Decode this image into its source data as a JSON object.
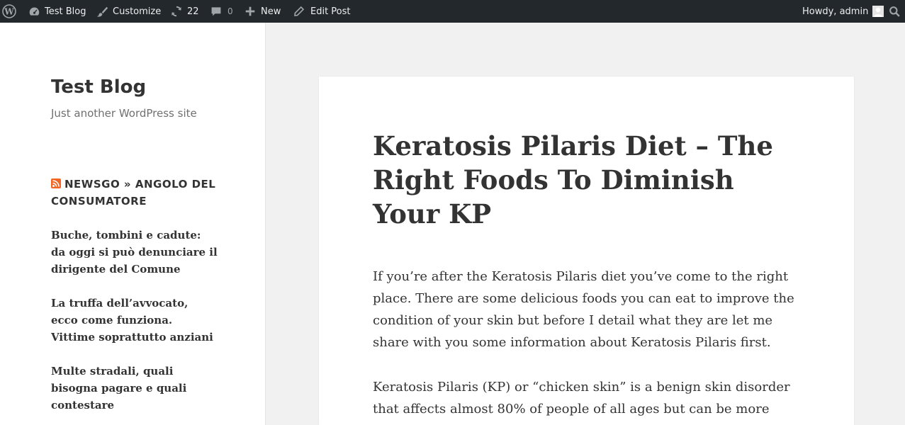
{
  "adminbar": {
    "wp_logo_icon": "wordpress-icon",
    "site_name": "Test Blog",
    "customize_label": "Customize",
    "updates_count": "22",
    "comments_count": "0",
    "new_label": "New",
    "edit_post_label": "Edit Post",
    "howdy_text": "Howdy, admin",
    "colors": {
      "background": "#23282d",
      "text": "#eeeeee"
    }
  },
  "sidebar": {
    "site_title": "Test Blog",
    "site_description": "Just another WordPress site",
    "widget_title": "NEWSGO » ANGOLO DEL CONSUMATORE",
    "feed_items": [
      "Buche, tombini e cadute: da oggi si può denunciare il dirigente del Comune",
      "La truffa dell’avvocato, ecco come funziona. Vittime soprattutto anziani",
      "Multe stradali, quali bisogna pagare e quali contestare"
    ]
  },
  "post": {
    "title": "Keratosis Pilaris Diet – The Right Foods To Diminish Your KP",
    "paragraphs": [
      "If you’re after the Keratosis Pilaris diet you’ve come to the right place. There are some delicious foods you can eat to improve the condition of your skin but before I detail what they are let me share with you some information about Keratosis Pilaris first.",
      "Keratosis Pilaris (KP) or “chicken skin” is a benign skin disorder that affects almost 80% of people of all ages but can be more"
    ]
  }
}
